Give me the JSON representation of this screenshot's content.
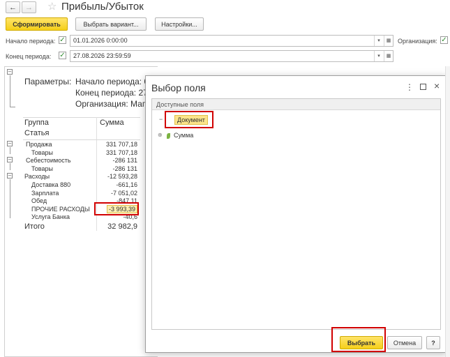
{
  "window": {
    "title": "Прибыль/Убыток"
  },
  "toolbar": {
    "generate_label": "Сформировать",
    "choose_variant_label": "Выбрать вариант...",
    "settings_label": "Настройки..."
  },
  "filters": {
    "start_label": "Начало периода:",
    "start_value": "01.01.2026  0:00:00",
    "end_label": "Конец периода:",
    "end_value": "27.08.2026 23:59:59",
    "org_label": "Организация:"
  },
  "report": {
    "params_label": "Параметры:",
    "param_start": "Начало периода: 0",
    "param_end": "Конец периода: 27",
    "param_org": "Организация: Магс",
    "col_group": "Группа",
    "col_sum": "Сумма",
    "col_article": "Статья",
    "rows": [
      {
        "name": "Продажа",
        "value": "331 707,18"
      },
      {
        "name": "Товары",
        "value": "331 707,18"
      },
      {
        "name": "Себестоимость",
        "value": "-286 131"
      },
      {
        "name": "Товары",
        "value": "-286 131"
      },
      {
        "name": "Расходы",
        "value": "-12 593,28"
      },
      {
        "name": "Доставка 880",
        "value": "-661,16"
      },
      {
        "name": "Зарплата",
        "value": "-7 051,02"
      },
      {
        "name": "Обед",
        "value": "-847,11"
      },
      {
        "name": "ПРОЧИЕ РАСХОДЫ",
        "value": "-3 993,39"
      },
      {
        "name": "Услуга Банка",
        "value": "-40,6"
      }
    ],
    "total_label": "Итого",
    "total_value": "32 982,9"
  },
  "dialog": {
    "title": "Выбор поля",
    "panel_header": "Доступные поля",
    "tree": [
      {
        "label": "Документ"
      },
      {
        "label": "Сумма"
      }
    ],
    "select_label": "Выбрать",
    "cancel_label": "Отмена",
    "help_label": "?"
  },
  "colors": {
    "accent": "#f5cf19",
    "highlight_box": "#d10000",
    "check": "#2f8d2f"
  },
  "icons": [
    "arrow-left-icon",
    "arrow-right-icon",
    "star-icon",
    "calendar-icon",
    "more-vert-icon",
    "maximize-icon",
    "close-icon",
    "tree-minus-icon",
    "tree-plus-icon",
    "leaf-icon"
  ]
}
